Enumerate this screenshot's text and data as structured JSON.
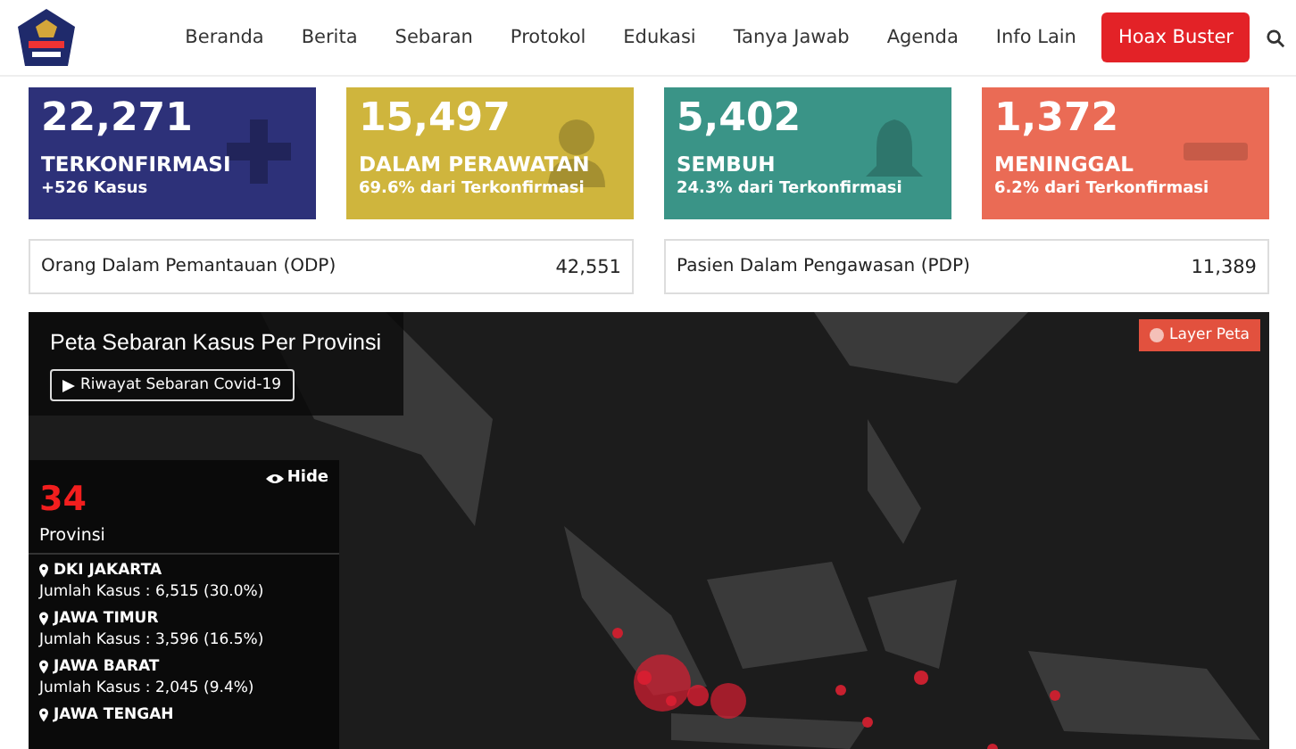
{
  "nav": {
    "items": [
      {
        "label": "Beranda",
        "kind": "link"
      },
      {
        "label": "Berita",
        "kind": "link"
      },
      {
        "label": "Sebaran",
        "kind": "link"
      },
      {
        "label": "Protokol",
        "kind": "link"
      },
      {
        "label": "Edukasi",
        "kind": "link"
      },
      {
        "label": "Tanya Jawab",
        "kind": "link"
      },
      {
        "label": "Agenda",
        "kind": "link"
      },
      {
        "label": "Info Lain",
        "kind": "link"
      },
      {
        "label": "Hoax Buster",
        "kind": "button"
      }
    ]
  },
  "stats": [
    {
      "value": "22,271",
      "label": "TERKONFIRMASI",
      "sub": "+526 Kasus",
      "color": "#2d3179"
    },
    {
      "value": "15,497",
      "label": "DALAM PERAWATAN",
      "sub": "69.6% dari Terkonfirmasi",
      "color": "#cfb53d"
    },
    {
      "value": "5,402",
      "label": "SEMBUH",
      "sub": "24.3% dari Terkonfirmasi",
      "color": "#3a9487"
    },
    {
      "value": "1,372",
      "label": "MENINGGAL",
      "sub": "6.2% dari Terkonfirmasi",
      "color": "#ea6b55"
    }
  ],
  "monitoring": [
    {
      "label": "Orang Dalam Pemantauan (ODP)",
      "value": "42,551"
    },
    {
      "label": "Pasien Dalam Pengawasan (PDP)",
      "value": "11,389"
    }
  ],
  "map": {
    "title": "Peta Sebaran Kasus Per Provinsi",
    "history_button": "Riwayat Sebaran Covid-19",
    "layer_button": "Layer Peta",
    "panel": {
      "hide": "Hide",
      "count": "34",
      "count_label": "Provinsi",
      "provinces": [
        {
          "name": "DKI JAKARTA",
          "cases": "Jumlah Kasus : 6,515 (30.0%)"
        },
        {
          "name": "JAWA TIMUR",
          "cases": "Jumlah Kasus : 3,596 (16.5%)"
        },
        {
          "name": "JAWA BARAT",
          "cases": "Jumlah Kasus : 2,045 (9.4%)"
        },
        {
          "name": "JAWA TENGAH"
        }
      ]
    }
  }
}
